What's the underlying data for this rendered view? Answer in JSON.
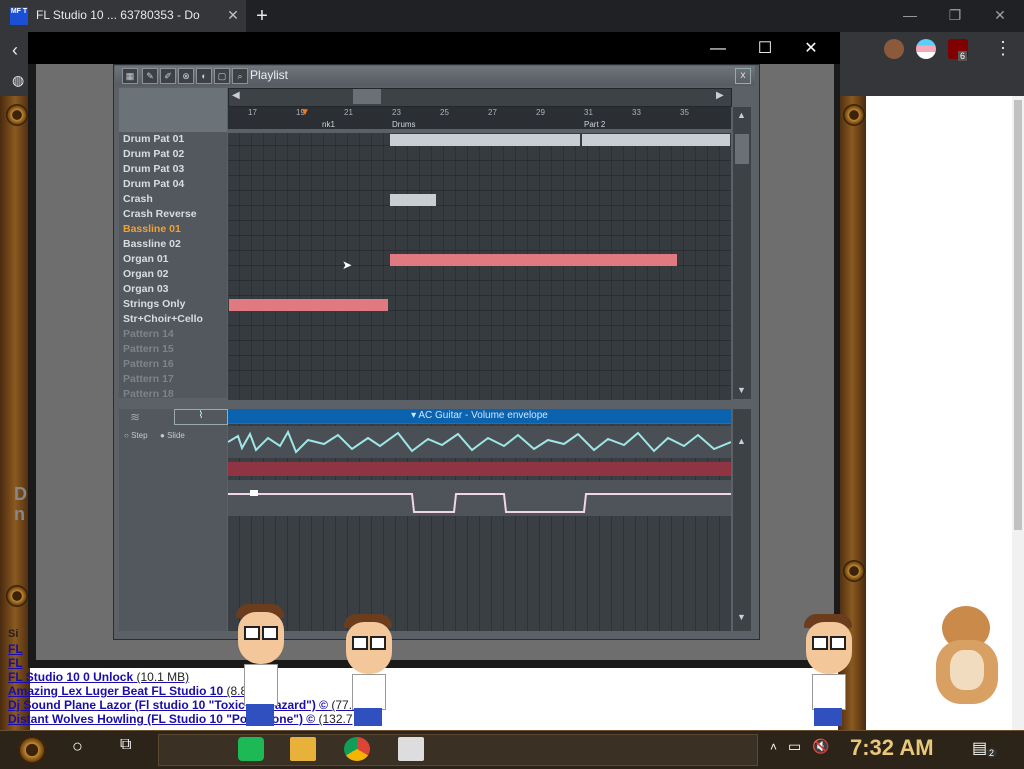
{
  "browser": {
    "tab_title": "FL Studio 10 ... 63780353 - Do",
    "tab_close": "✕",
    "new_tab": "+",
    "win_min": "—",
    "win_max": "❐",
    "win_close": "✕",
    "favicon_text": "MF T",
    "extension_badge": "6"
  },
  "video_window": {
    "min": "—",
    "max": "☐",
    "close": "✕"
  },
  "playlist": {
    "title": "Playlist",
    "close": "x",
    "patterns": [
      {
        "label": "Drum Pat 01",
        "state": "normal"
      },
      {
        "label": "Drum Pat 02",
        "state": "normal"
      },
      {
        "label": "Drum Pat 03",
        "state": "normal"
      },
      {
        "label": "Drum Pat 04",
        "state": "normal"
      },
      {
        "label": "Crash",
        "state": "normal"
      },
      {
        "label": "Crash Reverse",
        "state": "normal"
      },
      {
        "label": "Bassline 01",
        "state": "active"
      },
      {
        "label": "Bassline 02",
        "state": "normal"
      },
      {
        "label": "Organ 01",
        "state": "normal"
      },
      {
        "label": "Organ 02",
        "state": "normal"
      },
      {
        "label": "Organ 03",
        "state": "normal"
      },
      {
        "label": "Strings Only",
        "state": "normal"
      },
      {
        "label": "Str+Choir+Cello",
        "state": "normal"
      },
      {
        "label": "Pattern 14",
        "state": "dim"
      },
      {
        "label": "Pattern 15",
        "state": "dim"
      },
      {
        "label": "Pattern 16",
        "state": "dim"
      },
      {
        "label": "Pattern 17",
        "state": "dim"
      },
      {
        "label": "Pattern 18",
        "state": "dim"
      }
    ],
    "ruler_numbers": [
      "17",
      "19",
      "21",
      "23",
      "25",
      "27",
      "29",
      "31",
      "33",
      "35"
    ],
    "markers": [
      "nk1",
      "Drums",
      "Part 2"
    ],
    "automation_title": "▾ AC Guitar - Volume envelope",
    "auto_opts": [
      "Step",
      "Slide"
    ]
  },
  "page": {
    "heading_partial": "D",
    "heading_partial2": "n",
    "links": [
      {
        "text": "FL",
        "size": ""
      },
      {
        "text": "FL",
        "size": ""
      },
      {
        "text": "FL Studio 10 0 Unlock",
        "size": "(10.1 MB)"
      },
      {
        "text": "Amazing Lex Luger Beat FL Studio 10",
        "size": "(8.8 MB)"
      },
      {
        "text": "Dj Sound Plane Lazor (Fl studio 10 \"Toxic Biohazard\") ©",
        "size": "(77.0"
      },
      {
        "text": "Distant Wolves Howling (FL Studio 10 \"Polyphone\") ©",
        "size": "(132.7"
      }
    ],
    "si_label": "Si"
  },
  "taskbar": {
    "clock": "7:32 AM",
    "notif_count": "2"
  },
  "colors": {
    "clip_red": "#e07a80",
    "clip_gray": "#c9ced3",
    "active_pattern": "#f3a12e"
  }
}
